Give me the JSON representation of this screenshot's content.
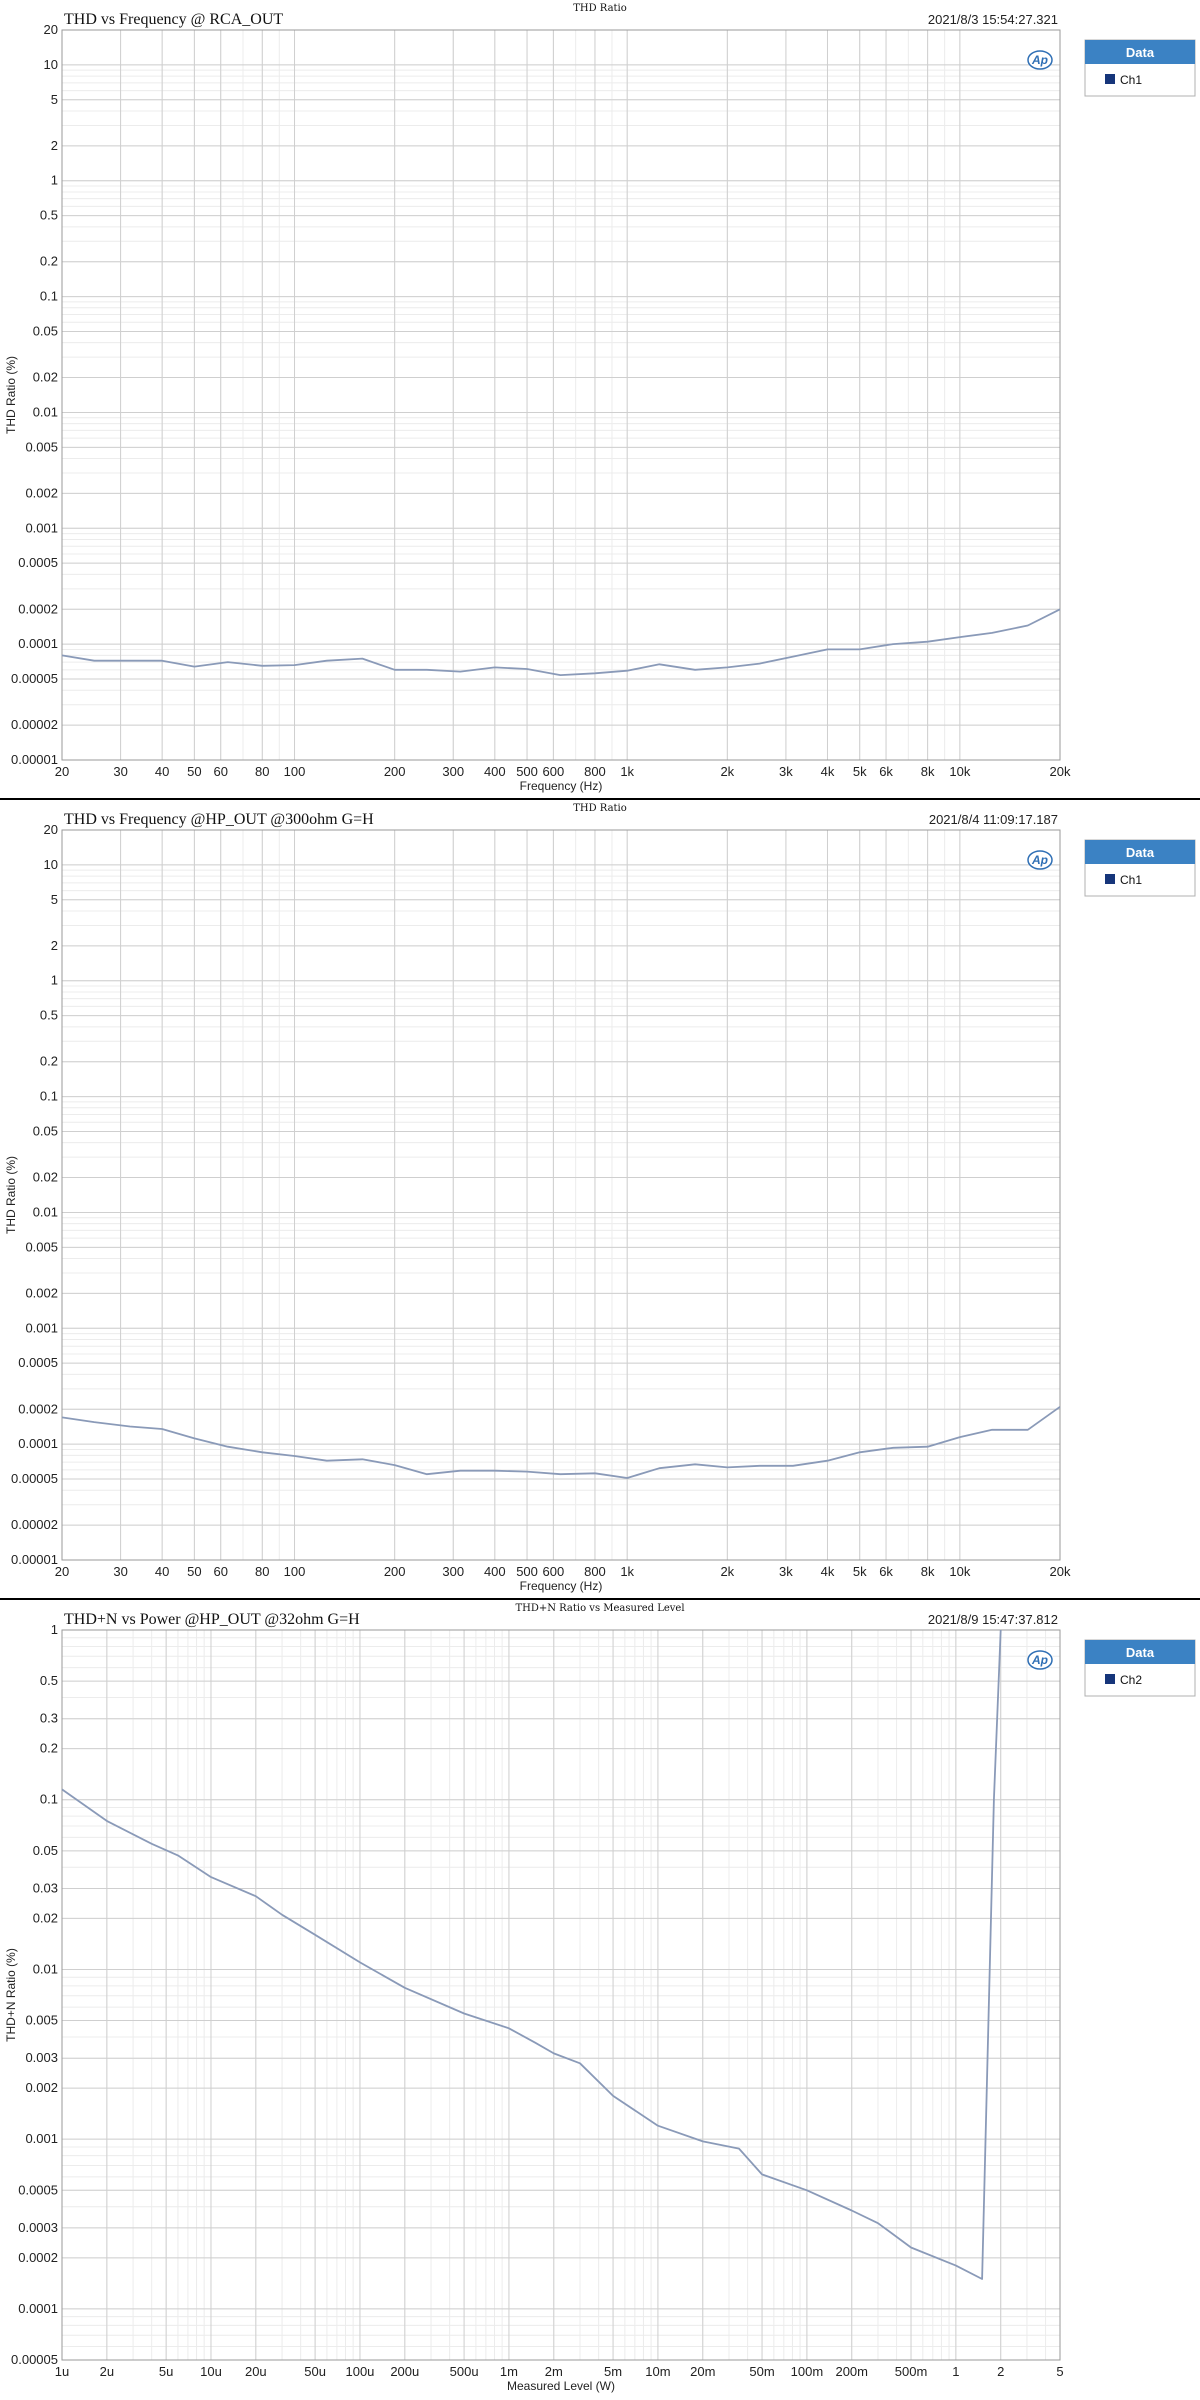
{
  "chart_data": [
    {
      "type": "line",
      "supertitle": "THD Ratio",
      "title": "THD vs Frequency @ RCA_OUT",
      "timestamp": "2021/8/3 15:54:27.321",
      "xlabel": "Frequency (Hz)",
      "ylabel": "THD Ratio (%)",
      "xscale": "log",
      "yscale": "log",
      "xlim": [
        20,
        20000
      ],
      "ylim": [
        1e-05,
        20
      ],
      "x_ticks": [
        20,
        30,
        40,
        50,
        60,
        80,
        100,
        200,
        300,
        400,
        500,
        600,
        800,
        1000,
        2000,
        3000,
        4000,
        5000,
        6000,
        8000,
        10000,
        20000
      ],
      "x_tick_labels": [
        "20",
        "30",
        "40",
        "50",
        "60",
        "80",
        "100",
        "200",
        "300",
        "400",
        "500",
        "600",
        "800",
        "1k",
        "2k",
        "3k",
        "4k",
        "5k",
        "6k",
        "8k",
        "10k",
        "20k"
      ],
      "y_ticks": [
        20,
        10,
        5,
        2,
        1,
        0.5,
        0.2,
        0.1,
        0.05,
        0.02,
        0.01,
        0.005,
        0.002,
        0.001,
        0.0005,
        0.0002,
        0.0001,
        5e-05,
        2e-05,
        1e-05
      ],
      "y_tick_labels": [
        "20",
        "10",
        "5",
        "2",
        "1",
        "0.5",
        "0.2",
        "0.1",
        "0.05",
        "0.02",
        "0.01",
        "0.005",
        "0.002",
        "0.001",
        "0.0005",
        "0.0002",
        "0.0001",
        "0.00005",
        "0.00002",
        "0.00001"
      ],
      "grid": true,
      "legend": {
        "title": "Data",
        "placement": "right",
        "entries": [
          "Ch1"
        ]
      },
      "series": [
        {
          "name": "Ch1",
          "color": "#8a9ab8",
          "x": [
            20,
            25,
            32,
            40,
            50,
            63,
            80,
            100,
            125,
            160,
            200,
            250,
            315,
            400,
            500,
            630,
            800,
            1000,
            1250,
            1600,
            2000,
            2500,
            3150,
            4000,
            5000,
            6300,
            8000,
            10000,
            12500,
            16000,
            20000
          ],
          "y": [
            8e-05,
            7.2e-05,
            7.2e-05,
            7.2e-05,
            6.4e-05,
            7e-05,
            6.5e-05,
            6.6e-05,
            7.2e-05,
            7.5e-05,
            6e-05,
            6e-05,
            5.8e-05,
            6.3e-05,
            6.1e-05,
            5.4e-05,
            5.6e-05,
            5.9e-05,
            6.7e-05,
            6e-05,
            6.3e-05,
            6.8e-05,
            7.8e-05,
            9e-05,
            9e-05,
            0.0001,
            0.000105,
            0.000115,
            0.000125,
            0.000145,
            0.0002
          ]
        }
      ]
    },
    {
      "type": "line",
      "supertitle": "THD Ratio",
      "title": "THD vs Frequency @HP_OUT @300ohm G=H",
      "timestamp": "2021/8/4 11:09:17.187",
      "xlabel": "Frequency (Hz)",
      "ylabel": "THD Ratio (%)",
      "xscale": "log",
      "yscale": "log",
      "xlim": [
        20,
        20000
      ],
      "ylim": [
        1e-05,
        20
      ],
      "x_ticks": [
        20,
        30,
        40,
        50,
        60,
        80,
        100,
        200,
        300,
        400,
        500,
        600,
        800,
        1000,
        2000,
        3000,
        4000,
        5000,
        6000,
        8000,
        10000,
        20000
      ],
      "x_tick_labels": [
        "20",
        "30",
        "40",
        "50",
        "60",
        "80",
        "100",
        "200",
        "300",
        "400",
        "500",
        "600",
        "800",
        "1k",
        "2k",
        "3k",
        "4k",
        "5k",
        "6k",
        "8k",
        "10k",
        "20k"
      ],
      "y_ticks": [
        20,
        10,
        5,
        2,
        1,
        0.5,
        0.2,
        0.1,
        0.05,
        0.02,
        0.01,
        0.005,
        0.002,
        0.001,
        0.0005,
        0.0002,
        0.0001,
        5e-05,
        2e-05,
        1e-05
      ],
      "y_tick_labels": [
        "20",
        "10",
        "5",
        "2",
        "1",
        "0.5",
        "0.2",
        "0.1",
        "0.05",
        "0.02",
        "0.01",
        "0.005",
        "0.002",
        "0.001",
        "0.0005",
        "0.0002",
        "0.0001",
        "0.00005",
        "0.00002",
        "0.00001"
      ],
      "grid": true,
      "legend": {
        "title": "Data",
        "placement": "right",
        "entries": [
          "Ch1"
        ]
      },
      "series": [
        {
          "name": "Ch1",
          "color": "#8a9ab8",
          "x": [
            20,
            25,
            32,
            40,
            50,
            63,
            80,
            100,
            125,
            160,
            200,
            250,
            315,
            400,
            500,
            630,
            800,
            1000,
            1250,
            1600,
            2000,
            2500,
            3150,
            4000,
            5000,
            6300,
            8000,
            10000,
            12500,
            16000,
            20000
          ],
          "y": [
            0.00017,
            0.000155,
            0.000142,
            0.000135,
            0.000112,
            9.5e-05,
            8.5e-05,
            7.9e-05,
            7.2e-05,
            7.4e-05,
            6.6e-05,
            5.5e-05,
            5.9e-05,
            5.9e-05,
            5.8e-05,
            5.5e-05,
            5.6e-05,
            5.1e-05,
            6.2e-05,
            6.7e-05,
            6.3e-05,
            6.5e-05,
            6.5e-05,
            7.2e-05,
            8.5e-05,
            9.3e-05,
            9.5e-05,
            0.000115,
            0.000133,
            0.000133,
            0.00021
          ]
        }
      ]
    },
    {
      "type": "line",
      "supertitle": "THD+N Ratio vs Measured Level",
      "title": "THD+N vs Power @HP_OUT @32ohm G=H",
      "timestamp": "2021/8/9 15:47:37.812",
      "xlabel": "Measured Level (W)",
      "ylabel": "THD+N Ratio (%)",
      "xscale": "log",
      "yscale": "log",
      "xlim": [
        1e-06,
        5
      ],
      "ylim": [
        5e-05,
        1
      ],
      "x_ticks": [
        1e-06,
        2e-06,
        5e-06,
        1e-05,
        2e-05,
        5e-05,
        0.0001,
        0.0002,
        0.0005,
        0.001,
        0.002,
        0.005,
        0.01,
        0.02,
        0.05,
        0.1,
        0.2,
        0.5,
        1,
        2,
        5
      ],
      "x_tick_labels": [
        "1u",
        "2u",
        "5u",
        "10u",
        "20u",
        "50u",
        "100u",
        "200u",
        "500u",
        "1m",
        "2m",
        "5m",
        "10m",
        "20m",
        "50m",
        "100m",
        "200m",
        "500m",
        "1",
        "2",
        "5"
      ],
      "y_ticks": [
        1,
        0.5,
        0.3,
        0.2,
        0.1,
        0.05,
        0.03,
        0.02,
        0.01,
        0.005,
        0.003,
        0.002,
        0.001,
        0.0005,
        0.0003,
        0.0002,
        0.0001,
        5e-05
      ],
      "y_tick_labels": [
        "1",
        "0.5",
        "0.3",
        "0.2",
        "0.1",
        "0.05",
        "0.03",
        "0.02",
        "0.01",
        "0.005",
        "0.003",
        "0.002",
        "0.001",
        "0.0005",
        "0.0003",
        "0.0002",
        "0.0001",
        "0.00005"
      ],
      "grid": true,
      "legend": {
        "title": "Data",
        "placement": "right",
        "entries": [
          "Ch2"
        ]
      },
      "series": [
        {
          "name": "Ch2",
          "color": "#8a9ab8",
          "x": [
            1e-06,
            2e-06,
            4e-06,
            6e-06,
            1e-05,
            2e-05,
            3e-05,
            5e-05,
            0.0001,
            0.0002,
            0.0005,
            0.001,
            0.0015,
            0.002,
            0.003,
            0.005,
            0.01,
            0.02,
            0.035,
            0.05,
            0.1,
            0.2,
            0.3,
            0.5,
            1,
            1.5,
            1.8,
            2
          ],
          "y": [
            0.115,
            0.075,
            0.055,
            0.047,
            0.035,
            0.027,
            0.021,
            0.016,
            0.011,
            0.0078,
            0.0055,
            0.0045,
            0.0037,
            0.0032,
            0.0028,
            0.0018,
            0.0012,
            0.00097,
            0.00088,
            0.00062,
            0.0005,
            0.00038,
            0.00032,
            0.00023,
            0.00018,
            0.00015,
            0.1,
            1
          ]
        }
      ]
    }
  ]
}
